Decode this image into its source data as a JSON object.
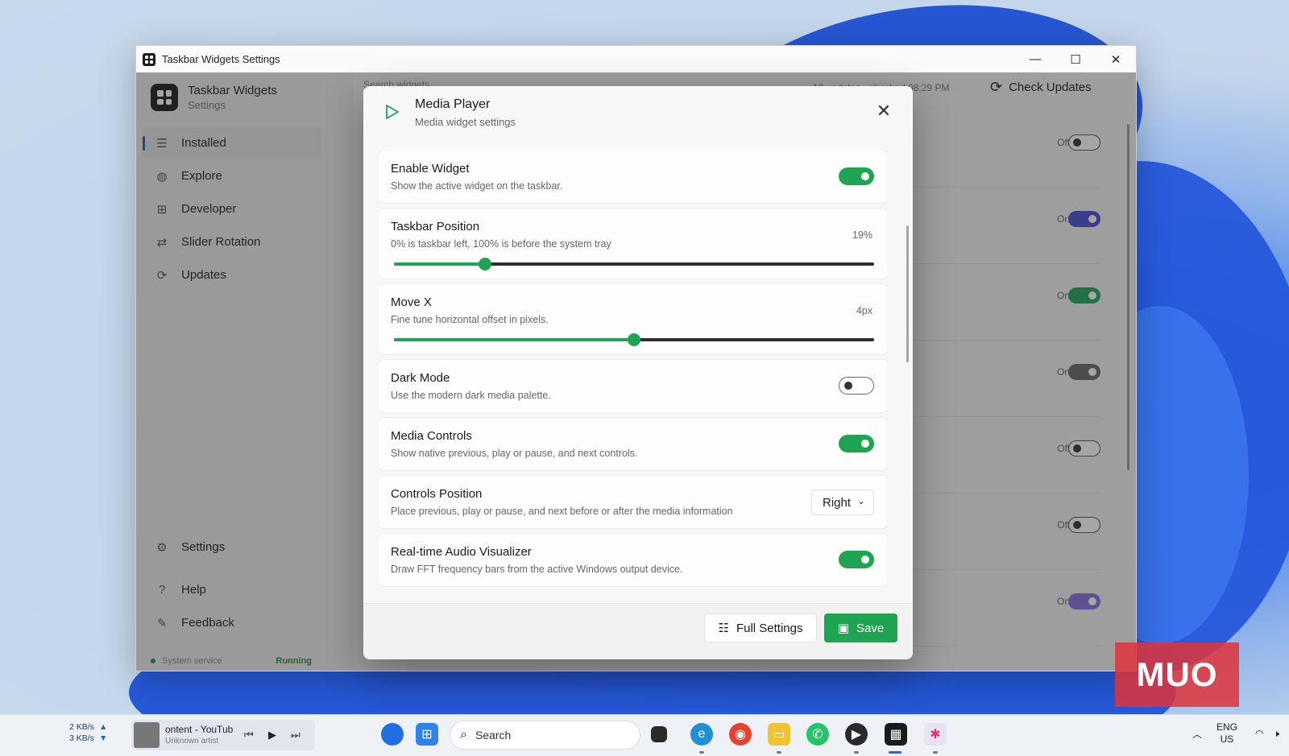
{
  "window": {
    "title": "Taskbar Widgets Settings",
    "controls": [
      "—",
      "☐",
      "✕"
    ]
  },
  "sidebar": {
    "brand_name": "Taskbar Widgets",
    "brand_sub": "Settings",
    "items": [
      {
        "label": "Installed",
        "icon": "list-icon"
      },
      {
        "label": "Explore",
        "icon": "globe-icon"
      },
      {
        "label": "Developer",
        "icon": "grid-icon"
      },
      {
        "label": "Slider Rotation",
        "icon": "arrows-icon"
      },
      {
        "label": "Updates",
        "icon": "refresh-icon"
      }
    ],
    "bottom_items": [
      {
        "label": "Settings",
        "icon": "gear-icon"
      },
      {
        "label": "Help",
        "icon": "question-icon"
      },
      {
        "label": "Feedback",
        "icon": "chat-icon"
      }
    ],
    "service_label": "System service",
    "service_status": "Running"
  },
  "topbar": {
    "search_placeholder": "Search widgets",
    "check_info": "10 updates · checked 08:29 PM",
    "check_label": "Check Updates"
  },
  "rows": [
    {
      "state": "Off",
      "on": false,
      "accent": "#2a2a2a"
    },
    {
      "state": "On",
      "on": true,
      "accent": "#4b4bd6",
      "color": "#4b4bd6"
    },
    {
      "state": "On",
      "on": true,
      "accent": "#1fa552",
      "color": "#1fa552"
    },
    {
      "state": "On",
      "on": true,
      "accent": "#555555",
      "color": "#666666"
    },
    {
      "state": "Off",
      "on": false,
      "accent": "#2a2a2a"
    },
    {
      "state": "Off",
      "on": false,
      "accent": "#2a2a2a"
    },
    {
      "state": "On",
      "on": true,
      "accent": "#7b5fd0",
      "color": "#8a6ce0"
    }
  ],
  "dialog": {
    "title": "Media Player",
    "subtitle": "Media widget settings",
    "settings": [
      {
        "type": "toggle",
        "title": "Enable Widget",
        "desc": "Show the active widget on the taskbar.",
        "on": true
      },
      {
        "type": "slider",
        "title": "Taskbar Position",
        "desc": "0% is taskbar left, 100% is before the system tray",
        "value": "19%",
        "fraction": 0.19
      },
      {
        "type": "slider",
        "title": "Move X",
        "desc": "Fine tune horizontal offset in pixels.",
        "value": "4px",
        "fraction": 0.5
      },
      {
        "type": "toggle",
        "title": "Dark Mode",
        "desc": "Use the modern dark media palette.",
        "on": false
      },
      {
        "type": "toggle",
        "title": "Media Controls",
        "desc": "Show native previous, play or pause, and next controls.",
        "on": true
      },
      {
        "type": "select",
        "title": "Controls Position",
        "desc": "Place previous, play or pause, and next before or after the media information",
        "value": "Right"
      },
      {
        "type": "toggle",
        "title": "Real-time Audio Visualizer",
        "desc": "Draw FFT frequency bars from the active Windows output device.",
        "on": true
      }
    ],
    "full_settings_label": "Full Settings",
    "save_label": "Save",
    "accent": "#1fa552"
  },
  "taskbar": {
    "net_up": "2 KB/s",
    "net_down": "3 KB/s",
    "media_title": "ontent - YouTub",
    "media_artist": "Unknown artist",
    "search_label": "Search",
    "lang_1": "ENG",
    "lang_2": "US"
  },
  "watermark": "MUO"
}
